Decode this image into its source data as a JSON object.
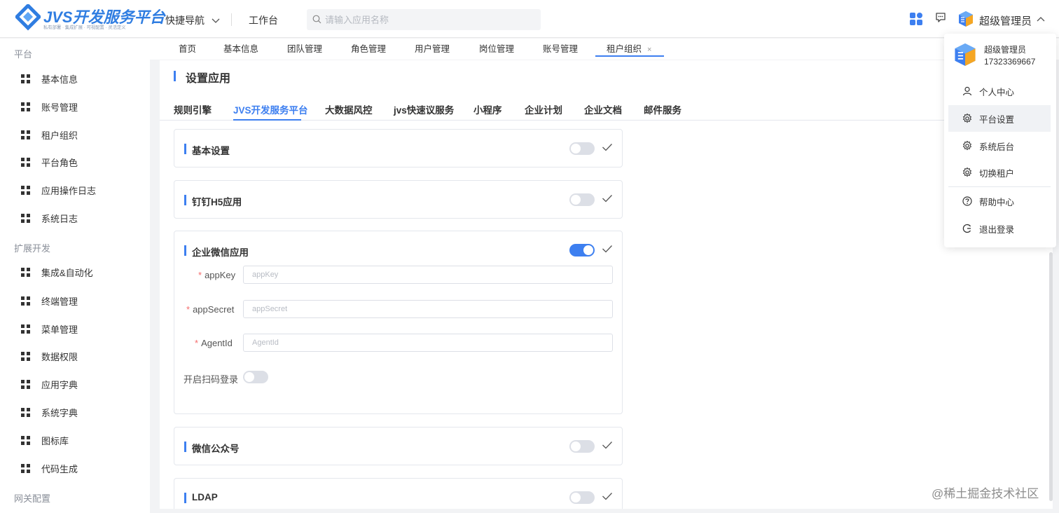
{
  "header": {
    "logo_title": "JVS开发服务平台",
    "logo_subtitle": "私有部署 · 集成扩展 · 可视配置 · 灵活定义",
    "quick_nav": "快捷导航",
    "workbench": "工作台",
    "search_placeholder": "请输入应用名称",
    "username": "超级管理员"
  },
  "sidebar": {
    "groups": [
      {
        "label": "平台",
        "items": [
          "基本信息",
          "账号管理",
          "租户组织",
          "平台角色",
          "应用操作日志",
          "系统日志"
        ]
      },
      {
        "label": "扩展开发",
        "items": [
          "集成&自动化",
          "终端管理",
          "菜单管理",
          "数据权限",
          "应用字典",
          "系统字典",
          "图标库",
          "代码生成"
        ]
      },
      {
        "label": "网关配置",
        "items": []
      }
    ]
  },
  "tabs": [
    "首页",
    "基本信息",
    "团队管理",
    "角色管理",
    "用户管理",
    "岗位管理",
    "账号管理",
    "租户组织"
  ],
  "tabs_close": "×",
  "page": {
    "title": "设置应用",
    "subtabs": [
      "规则引擎",
      "JVS开发服务平台",
      "大数据风控",
      "jvs快速议服务",
      "小程序",
      "企业计划",
      "企业文档",
      "邮件服务"
    ],
    "cards": [
      {
        "title": "基本设置",
        "enabled": false
      },
      {
        "title": "钉钉H5应用",
        "enabled": false
      },
      {
        "title": "企业微信应用",
        "enabled": true
      },
      {
        "title": "微信公众号",
        "enabled": false
      },
      {
        "title": "LDAP",
        "enabled": false
      }
    ],
    "wecom_form": {
      "appkey_label": "appKey",
      "appkey_placeholder": "appKey",
      "appsecret_label": "appSecret",
      "appsecret_placeholder": "appSecret",
      "agentid_label": "AgentId",
      "agentid_placeholder": "AgentId",
      "required_mark": "*",
      "scan_login_label": "开启扫码登录",
      "scan_login_enabled": false
    }
  },
  "dropdown": {
    "name": "超级管理员",
    "phone": "17323369667",
    "items": [
      "个人中心",
      "平台设置",
      "系统后台",
      "切换租户",
      "帮助中心",
      "退出登录"
    ],
    "highlighted": "平台设置"
  },
  "watermark": "@稀土掘金技术社区",
  "colors": {
    "accent": "#3d7ff0",
    "required": "#f56c6c"
  }
}
